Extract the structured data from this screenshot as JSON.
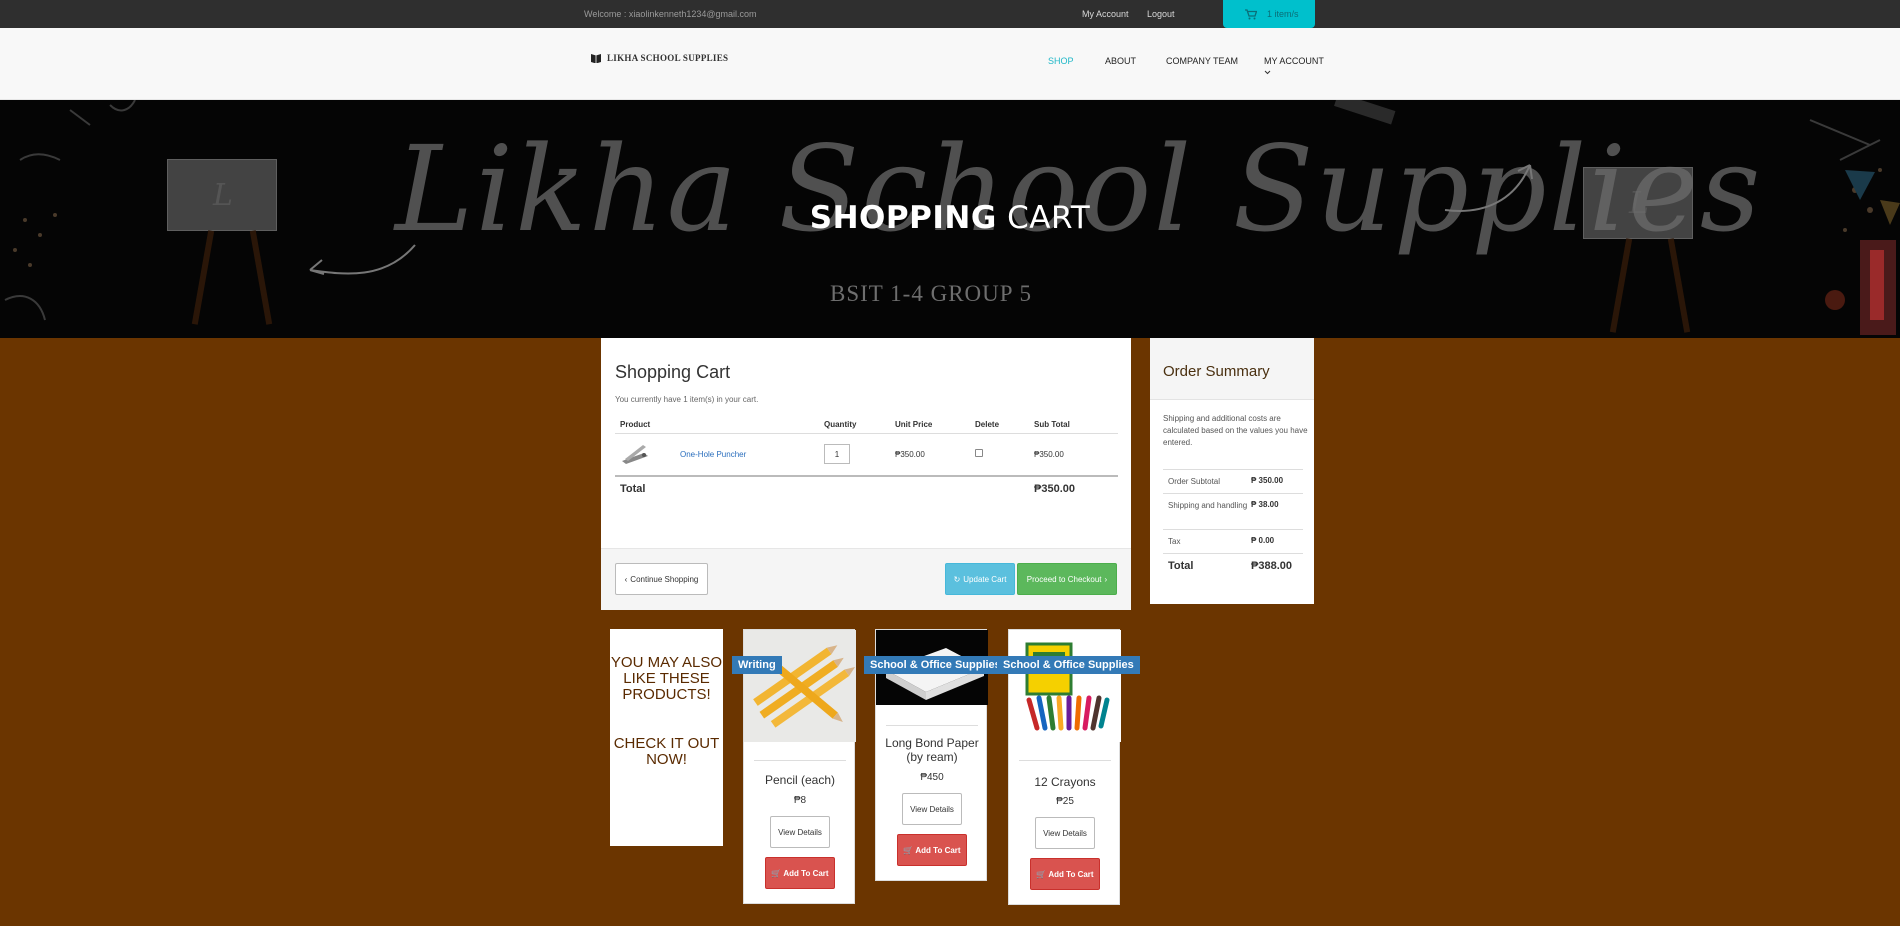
{
  "topbar": {
    "welcome": "Welcome : xiaolinkenneth1234@gmail.com",
    "my_account": "My Account",
    "logout": "Logout",
    "cart_count": "1 item/s"
  },
  "nav": {
    "logo_text": "LIKHA SCHOOL SUPPLIES",
    "items": [
      "SHOP",
      "ABOUT",
      "COMPANY TEAM",
      "MY ACCOUNT"
    ]
  },
  "hero": {
    "script_text": "Likha School Supplies",
    "title_bold": "SHOPPING",
    "title_light": "CART",
    "subtitle": "BSIT 1-4 GROUP 5",
    "easel_letter": "L"
  },
  "cart": {
    "title": "Shopping Cart",
    "subtitle": "You currently have 1 item(s) in your cart.",
    "headers": [
      "Product",
      "Quantity",
      "Unit Price",
      "Delete",
      "Sub Total"
    ],
    "rows": [
      {
        "name": "One-Hole Puncher",
        "qty": "1",
        "unit_price": "₱350.00",
        "sub_total": "₱350.00"
      }
    ],
    "total_label": "Total",
    "total_value": "₱350.00",
    "continue_label": "Continue Shopping",
    "update_label": "Update Cart",
    "checkout_label": "Proceed to Checkout"
  },
  "summary": {
    "title": "Order Summary",
    "note": "Shipping and additional costs are calculated based on the values you have entered.",
    "rows": [
      {
        "label": "Order Subtotal",
        "value": "₱ 350.00"
      },
      {
        "label": "Shipping and handling",
        "value": "₱ 38.00"
      },
      {
        "label": "Tax",
        "value": "₱ 0.00"
      }
    ],
    "total_label": "Total",
    "total_value": "₱388.00"
  },
  "promo": {
    "line1": "YOU MAY ALSO LIKE THESE PRODUCTS!",
    "line2": "CHECK IT OUT NOW!"
  },
  "products": [
    {
      "category": "Writing",
      "name": "Pencil (each)",
      "price": "₱8",
      "details_label": "View Details",
      "cart_label": "Add To Cart"
    },
    {
      "category": "School & Office Supplies",
      "name": "Long Bond Paper (by ream)",
      "price": "₱450",
      "details_label": "View Details",
      "cart_label": "Add To Cart"
    },
    {
      "category": "School & Office Supplies",
      "name": "12 Crayons",
      "price": "₱25",
      "details_label": "View Details",
      "cart_label": "Add To Cart"
    }
  ],
  "colors": {
    "page_bg": "#6b3500",
    "accent_teal": "#00c0cc",
    "update_btn": "#5bc0de",
    "checkout_btn": "#5cb85c",
    "add_to_cart_btn": "#d9534f",
    "badge": "#337ab7"
  }
}
